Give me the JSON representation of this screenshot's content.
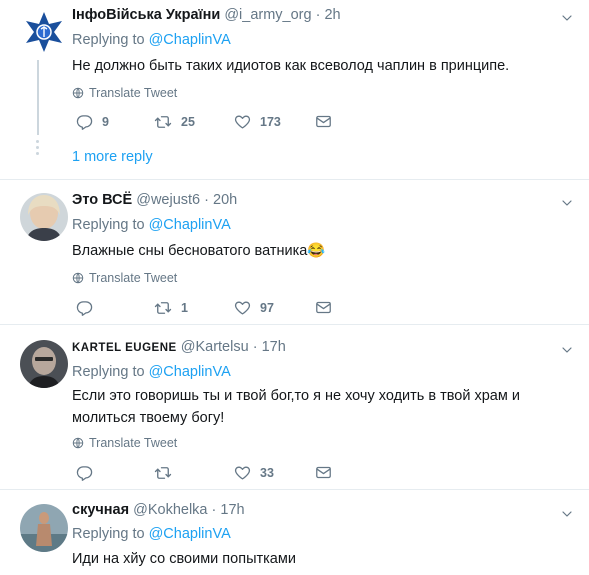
{
  "tweets": [
    {
      "name": "ІнфоВійська України",
      "handle": "@i_army_org",
      "dot": "·",
      "time": "2h",
      "replying_prefix": "Replying to ",
      "replying_mention": "@ChaplinVA",
      "text": "Не должно быть таких идиотов как всеволод чаплин в принципе.",
      "translate": "Translate Tweet",
      "replies": "9",
      "retweets": "25",
      "likes": "173",
      "more_reply": "1 more reply"
    },
    {
      "name": "Это ВСЁ",
      "handle": "@wejust6",
      "dot": "·",
      "time": "20h",
      "replying_prefix": "Replying to ",
      "replying_mention": "@ChaplinVA",
      "text": "Влажные сны бесноватого ватника😂",
      "translate": "Translate Tweet",
      "replies": "",
      "retweets": "1",
      "likes": "97"
    },
    {
      "name": "KARTEL EUGENE",
      "handle": "@Kartelsu",
      "dot": "·",
      "time": "17h",
      "replying_prefix": "Replying to ",
      "replying_mention": "@ChaplinVA",
      "text": "Если это говоришь ты и твой бог,то я не хочу ходить в твой храм и молиться твоему богу!",
      "translate": "Translate Tweet",
      "replies": "",
      "retweets": "",
      "likes": "33"
    },
    {
      "name": "скучная",
      "handle": "@Kokhelka",
      "dot": "·",
      "time": "17h",
      "replying_prefix": "Replying to ",
      "replying_mention": "@ChaplinVA",
      "text": "Иди на хйу со своими попытками"
    }
  ],
  "colors": {
    "accent": "#1da1f2",
    "muted": "#657786",
    "text": "#14171a",
    "border": "#e6ecf0"
  },
  "icons": [
    "reply-icon",
    "retweet-icon",
    "like-icon",
    "message-icon",
    "globe-icon",
    "chevron-down-icon"
  ]
}
